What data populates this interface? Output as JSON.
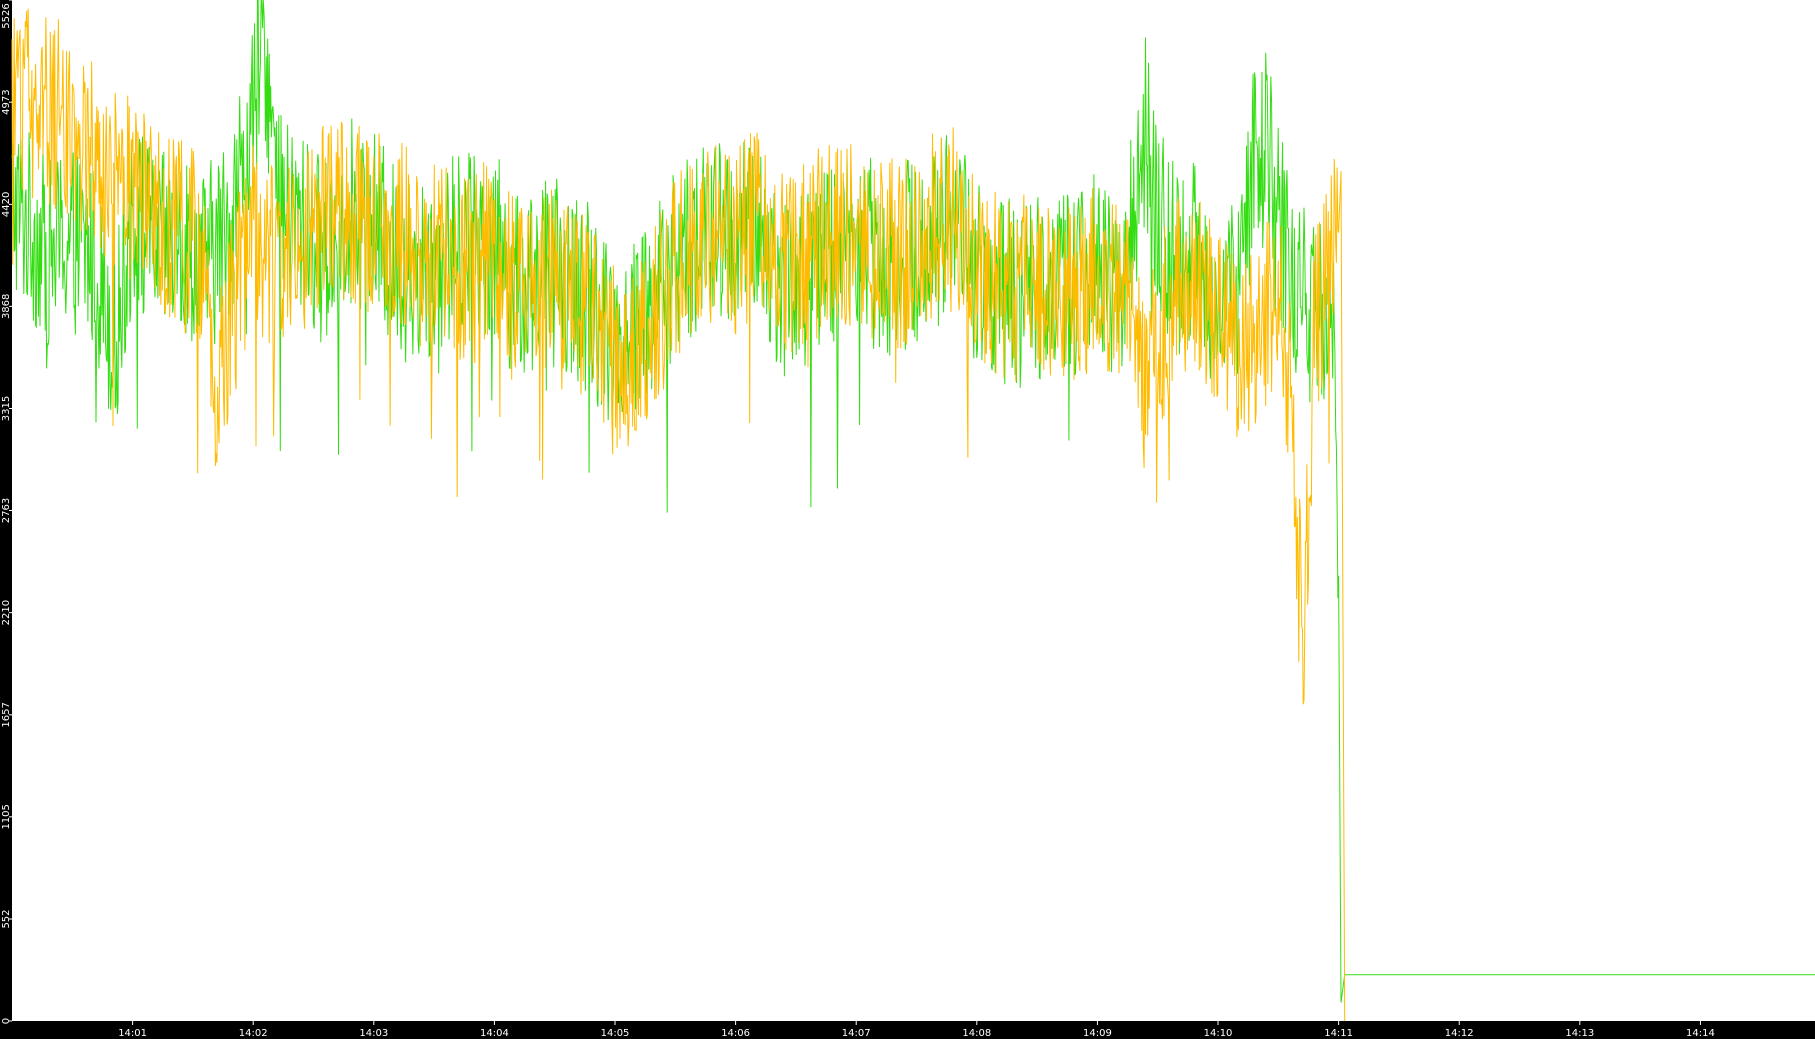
{
  "colors": {
    "background": "#000000",
    "plot_area": "#ffffff",
    "text": "#ffffff",
    "series_green": "#33dd11",
    "series_orange": "#ffbb00"
  },
  "chart_data": {
    "type": "line",
    "title": "",
    "xlabel": "",
    "ylabel": "",
    "ylim": [
      0,
      5526
    ],
    "xlim_minutes": [
      0,
      14.95
    ],
    "grid": false,
    "legend": "none",
    "y_ticks": [
      {
        "value": 0,
        "label": "0"
      },
      {
        "value": 552,
        "label": "552"
      },
      {
        "value": 1105,
        "label": "1105"
      },
      {
        "value": 1657,
        "label": "1657"
      },
      {
        "value": 2210,
        "label": "2210"
      },
      {
        "value": 2763,
        "label": "2763"
      },
      {
        "value": 3315,
        "label": "3315"
      },
      {
        "value": 3868,
        "label": "3868"
      },
      {
        "value": 4420,
        "label": "4420"
      },
      {
        "value": 4973,
        "label": "4973"
      },
      {
        "value": 5526,
        "label": "5526"
      }
    ],
    "x_ticks": [
      {
        "value": 1,
        "label": "14:01"
      },
      {
        "value": 2,
        "label": "14:02"
      },
      {
        "value": 3,
        "label": "14:03"
      },
      {
        "value": 4,
        "label": "14:04"
      },
      {
        "value": 5,
        "label": "14:05"
      },
      {
        "value": 6,
        "label": "14:06"
      },
      {
        "value": 7,
        "label": "14:07"
      },
      {
        "value": 8,
        "label": "14:08"
      },
      {
        "value": 9,
        "label": "14:09"
      },
      {
        "value": 10,
        "label": "14:10"
      },
      {
        "value": 11,
        "label": "14:11"
      },
      {
        "value": 12,
        "label": "14:12"
      },
      {
        "value": 13,
        "label": "14:13"
      },
      {
        "value": 14,
        "label": "14:14"
      }
    ],
    "series": [
      {
        "color": "#33dd11",
        "points": [
          [
            0,
            4450
          ],
          [
            0.15,
            4300
          ],
          [
            0.3,
            4150
          ],
          [
            0.5,
            4250
          ],
          [
            0.7,
            4100
          ],
          [
            0.85,
            3700
          ],
          [
            1.0,
            4350
          ],
          [
            1.2,
            4200
          ],
          [
            1.4,
            4150
          ],
          [
            1.6,
            4100
          ],
          [
            1.8,
            4300
          ],
          [
            2.0,
            4900
          ],
          [
            2.1,
            5300
          ],
          [
            2.2,
            4400
          ],
          [
            2.4,
            4300
          ],
          [
            2.6,
            4150
          ],
          [
            2.8,
            4400
          ],
          [
            3.0,
            4300
          ],
          [
            3.2,
            4100
          ],
          [
            3.4,
            4050
          ],
          [
            3.6,
            4150
          ],
          [
            3.8,
            4250
          ],
          [
            4.0,
            4200
          ],
          [
            4.2,
            3950
          ],
          [
            4.4,
            4100
          ],
          [
            4.6,
            4000
          ],
          [
            4.8,
            3900
          ],
          [
            5.0,
            3700
          ],
          [
            5.2,
            3800
          ],
          [
            5.4,
            4000
          ],
          [
            5.6,
            4200
          ],
          [
            5.8,
            4250
          ],
          [
            6.0,
            4250
          ],
          [
            6.2,
            4250
          ],
          [
            6.4,
            4000
          ],
          [
            6.6,
            4000
          ],
          [
            6.8,
            4150
          ],
          [
            7.0,
            4300
          ],
          [
            7.2,
            4100
          ],
          [
            7.4,
            4150
          ],
          [
            7.6,
            4200
          ],
          [
            7.8,
            4400
          ],
          [
            8.0,
            4050
          ],
          [
            8.2,
            3950
          ],
          [
            8.4,
            3900
          ],
          [
            8.6,
            4050
          ],
          [
            8.8,
            4000
          ],
          [
            9.0,
            4100
          ],
          [
            9.2,
            3900
          ],
          [
            9.4,
            4850
          ],
          [
            9.5,
            4300
          ],
          [
            9.7,
            4150
          ],
          [
            9.9,
            4100
          ],
          [
            10.0,
            3800
          ],
          [
            10.2,
            4000
          ],
          [
            10.3,
            4700
          ],
          [
            10.4,
            4900
          ],
          [
            10.5,
            4400
          ],
          [
            10.6,
            4000
          ],
          [
            10.8,
            3850
          ],
          [
            10.95,
            3900
          ],
          [
            11.0,
            2400
          ],
          [
            11.02,
            100
          ],
          [
            11.05,
            250
          ],
          [
            11.5,
            250
          ],
          [
            12.0,
            250
          ],
          [
            13.0,
            250
          ],
          [
            14.0,
            250
          ],
          [
            14.95,
            250
          ]
        ]
      },
      {
        "color": "#ffbb00",
        "points": [
          [
            0,
            5050
          ],
          [
            0.2,
            4950
          ],
          [
            0.4,
            4900
          ],
          [
            0.6,
            4750
          ],
          [
            0.8,
            4550
          ],
          [
            1.0,
            4500
          ],
          [
            1.2,
            4350
          ],
          [
            1.4,
            4250
          ],
          [
            1.6,
            4150
          ],
          [
            1.7,
            3300
          ],
          [
            1.8,
            3800
          ],
          [
            2.0,
            4250
          ],
          [
            2.2,
            4150
          ],
          [
            2.4,
            4200
          ],
          [
            2.6,
            4350
          ],
          [
            2.8,
            4400
          ],
          [
            3.0,
            4300
          ],
          [
            3.2,
            4250
          ],
          [
            3.4,
            4150
          ],
          [
            3.6,
            4100
          ],
          [
            3.8,
            4050
          ],
          [
            4.0,
            4200
          ],
          [
            4.2,
            3900
          ],
          [
            4.4,
            4050
          ],
          [
            4.6,
            3900
          ],
          [
            4.8,
            3900
          ],
          [
            5.0,
            3550
          ],
          [
            5.2,
            3650
          ],
          [
            5.4,
            3900
          ],
          [
            5.6,
            4200
          ],
          [
            5.8,
            4300
          ],
          [
            6.0,
            4200
          ],
          [
            6.2,
            4350
          ],
          [
            6.4,
            4100
          ],
          [
            6.6,
            4150
          ],
          [
            6.8,
            4300
          ],
          [
            7.0,
            4250
          ],
          [
            7.2,
            4150
          ],
          [
            7.4,
            4150
          ],
          [
            7.6,
            4300
          ],
          [
            7.8,
            4350
          ],
          [
            8.0,
            4100
          ],
          [
            8.2,
            4000
          ],
          [
            8.4,
            3950
          ],
          [
            8.6,
            3950
          ],
          [
            8.8,
            3950
          ],
          [
            9.0,
            4050
          ],
          [
            9.2,
            3950
          ],
          [
            9.4,
            3450
          ],
          [
            9.6,
            3900
          ],
          [
            9.8,
            4050
          ],
          [
            10.0,
            3750
          ],
          [
            10.2,
            3650
          ],
          [
            10.4,
            3800
          ],
          [
            10.5,
            3900
          ],
          [
            10.6,
            3500
          ],
          [
            10.7,
            2000
          ],
          [
            10.8,
            3750
          ],
          [
            10.9,
            4000
          ],
          [
            11.0,
            4400
          ],
          [
            11.02,
            4600
          ],
          [
            11.05,
            0
          ]
        ]
      }
    ]
  }
}
